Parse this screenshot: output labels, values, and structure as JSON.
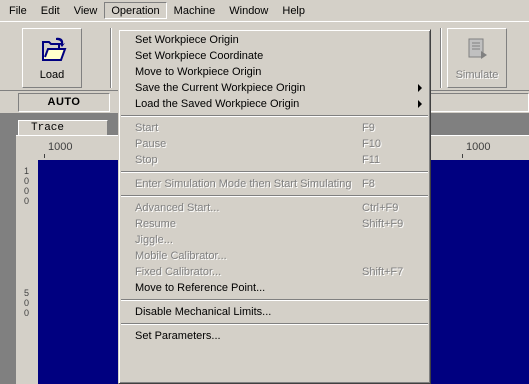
{
  "menubar": {
    "items": [
      {
        "label": "File"
      },
      {
        "label": "Edit"
      },
      {
        "label": "View"
      },
      {
        "label": "Operation"
      },
      {
        "label": "Machine"
      },
      {
        "label": "Window"
      },
      {
        "label": "Help"
      }
    ]
  },
  "toolbar": {
    "load_label": "Load",
    "simulate_label": "Simulate"
  },
  "mode": {
    "label": "AUTO"
  },
  "trace": {
    "tab_label": "Trace",
    "ruler_top_left": "1000",
    "ruler_top_right": "1000",
    "ruler_left_1": "1000",
    "ruler_left_2": "500"
  },
  "operation_menu": {
    "groups": [
      [
        {
          "label": "Set Workpiece Origin",
          "disabled": false
        },
        {
          "label": "Set Workpiece Coordinate",
          "disabled": false
        },
        {
          "label": "Move to Workpiece Origin",
          "disabled": false
        },
        {
          "label": "Save the Current Workpiece Origin",
          "disabled": false,
          "submenu": true
        },
        {
          "label": "Load the Saved Workpiece Origin",
          "disabled": false,
          "submenu": true
        }
      ],
      [
        {
          "label": "Start",
          "shortcut": "F9",
          "disabled": true
        },
        {
          "label": "Pause",
          "shortcut": "F10",
          "disabled": true
        },
        {
          "label": "Stop",
          "shortcut": "F11",
          "disabled": true
        }
      ],
      [
        {
          "label": "Enter Simulation Mode then Start Simulating",
          "shortcut": "F8",
          "disabled": true
        }
      ],
      [
        {
          "label": "Advanced Start...",
          "shortcut": "Ctrl+F9",
          "disabled": true
        },
        {
          "label": "Resume",
          "shortcut": "Shift+F9",
          "disabled": true
        },
        {
          "label": "Jiggle...",
          "disabled": true
        },
        {
          "label": "Mobile Calibrator...",
          "disabled": true
        },
        {
          "label": "Fixed Calibrator...",
          "shortcut": "Shift+F7",
          "disabled": true
        },
        {
          "label": "Move to Reference Point...",
          "disabled": false
        }
      ],
      [
        {
          "label": "Disable Mechanical Limits...",
          "disabled": false
        }
      ],
      [
        {
          "label": "Set Parameters...",
          "disabled": false
        }
      ]
    ]
  }
}
